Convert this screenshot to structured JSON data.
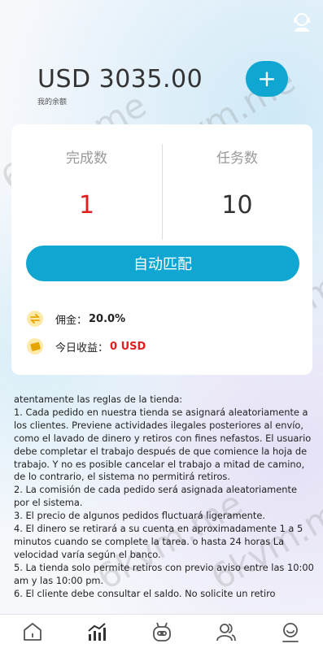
{
  "header": {
    "balance": "USD 3035.00",
    "balance_caption": "我的余额",
    "add_label": "+"
  },
  "stats": {
    "completed_label": "完成数",
    "completed_value": "1",
    "tasks_label": "任务数",
    "tasks_value": "10"
  },
  "match_button": "自动匹配",
  "commission": {
    "label": "佣金：",
    "value": "20.0%"
  },
  "earnings": {
    "label": "今日收益：",
    "value": "0 USD"
  },
  "rules_text": " atentamente las reglas de la tienda:\n1. Cada pedido en nuestra tienda se asignará aleatoriamente a los clientes. Previene actividades ilegales posteriores al envío, como el lavado de dinero y retiros con fines nefastos. El usuario debe completar el trabajo después de que comience la hoja de trabajo. Y no es posible cancelar el trabajo a mitad de camino, de lo contrario, el sistema no permitirá retiros.\n2. La comisión de cada pedido será asignada aleatoriamente por el sistema.\n3. El precio de algunos pedidos fluctuará ligeramente.\n4. El dinero se retirará a su cuenta en aproximadamente 1 a 5 minutos cuando se complete la tarea. o hasta 24 horas La velocidad varía según el banco.\n5. La tienda solo permite retiros con previo aviso entre las 10:00 am y las 10:00 pm.\n6. El cliente debe consultar el saldo. No solicite un retiro",
  "watermark": "6kvm.me",
  "colors": {
    "accent": "#0fa7d1",
    "red": "#e02020"
  },
  "nav": [
    "home-icon",
    "chart-icon",
    "robot-icon",
    "team-icon",
    "profile-icon"
  ]
}
